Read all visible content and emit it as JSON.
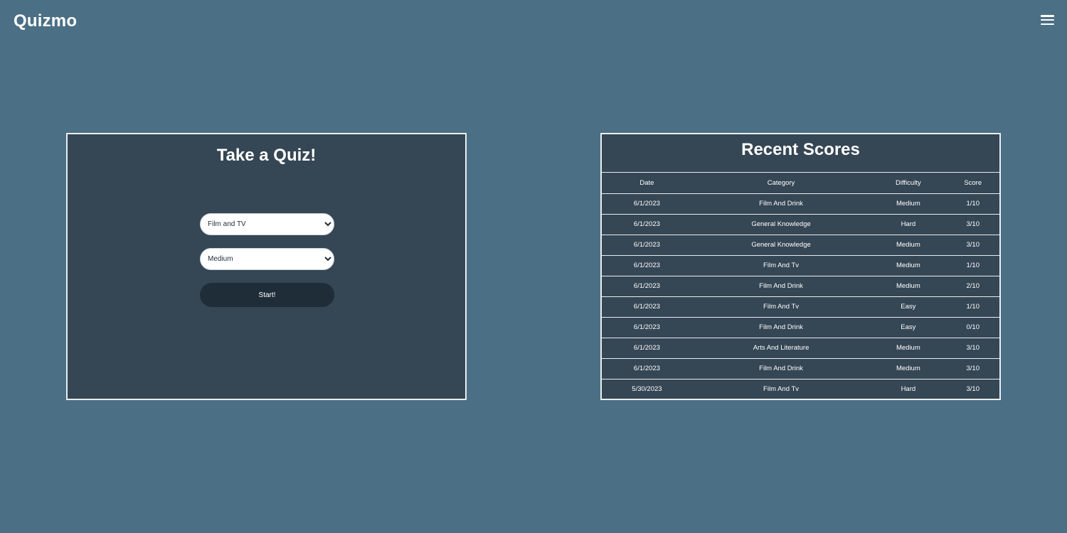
{
  "header": {
    "brand": "Quizmo",
    "menu_icon": "hamburger-menu-icon"
  },
  "quiz": {
    "title": "Take a Quiz!",
    "category_selected": "Film and TV",
    "difficulty_selected": "Medium",
    "start_label": "Start!"
  },
  "scores": {
    "title": "Recent Scores",
    "columns": [
      "Date",
      "Category",
      "Difficulty",
      "Score"
    ],
    "rows": [
      [
        "6/1/2023",
        "Film And Drink",
        "Medium",
        "1/10"
      ],
      [
        "6/1/2023",
        "General Knowledge",
        "Hard",
        "3/10"
      ],
      [
        "6/1/2023",
        "General Knowledge",
        "Medium",
        "3/10"
      ],
      [
        "6/1/2023",
        "Film And Tv",
        "Medium",
        "1/10"
      ],
      [
        "6/1/2023",
        "Film And Drink",
        "Medium",
        "2/10"
      ],
      [
        "6/1/2023",
        "Film And Tv",
        "Easy",
        "1/10"
      ],
      [
        "6/1/2023",
        "Film And Drink",
        "Easy",
        "0/10"
      ],
      [
        "6/1/2023",
        "Arts And Literature",
        "Medium",
        "3/10"
      ],
      [
        "6/1/2023",
        "Film And Drink",
        "Medium",
        "3/10"
      ],
      [
        "5/30/2023",
        "Film And Tv",
        "Hard",
        "3/10"
      ]
    ]
  },
  "colors": {
    "page_background": "#4b6f84",
    "panel_background": "#354654",
    "button_background": "#1f2d38",
    "border": "#e9eef2"
  }
}
